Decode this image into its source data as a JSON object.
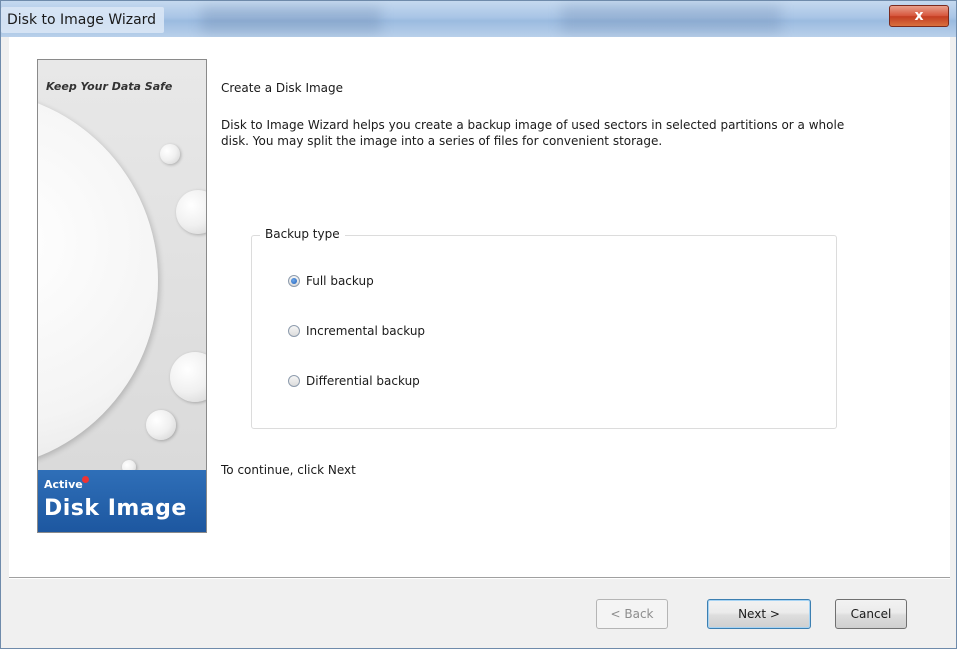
{
  "window": {
    "title": "Disk to Image Wizard"
  },
  "titlebar": {
    "close_icon": "close-icon",
    "close_glyph": "x"
  },
  "art": {
    "caption": "Keep Your Data Safe",
    "logo_small": "Active",
    "logo_big": "Disk Image"
  },
  "content": {
    "heading": "Create a Disk Image",
    "description": "Disk to Image Wizard helps you create a backup image of used sectors in selected partitions or a whole disk. You may split the image into a series of files for convenient storage.",
    "backup_group_label": "Backup type",
    "options": [
      {
        "label": "Full backup",
        "checked": true
      },
      {
        "label": "Incremental backup",
        "checked": false
      },
      {
        "label": "Differential backup",
        "checked": false
      }
    ],
    "continue_text": "To continue, click Next"
  },
  "buttons": {
    "back": "< Back",
    "next": "Next >",
    "cancel": "Cancel"
  },
  "colors": {
    "logo_blue": "#1d57a0",
    "close_red": "#c33c22"
  }
}
